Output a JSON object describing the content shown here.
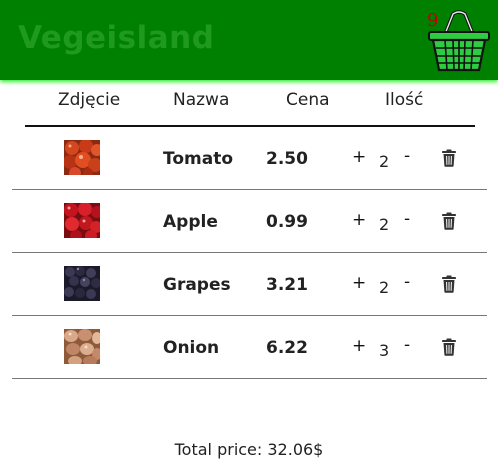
{
  "app": {
    "brand": "Vegeisland",
    "cart_count": "9"
  },
  "table": {
    "headers": {
      "photo": "Zdjęcie",
      "name": "Nazwa",
      "price": "Cena",
      "qty": "Ilość"
    },
    "items": [
      {
        "name": "Tomato",
        "price": "2.50",
        "qty": "2",
        "plus": "+",
        "minus": "-",
        "image": "tomato-photo"
      },
      {
        "name": "Apple",
        "price": "0.99",
        "qty": "2",
        "plus": "+",
        "minus": "-",
        "image": "apple-photo"
      },
      {
        "name": "Grapes",
        "price": "3.21",
        "qty": "2",
        "plus": "+",
        "minus": "-",
        "image": "grapes-photo"
      },
      {
        "name": "Onion",
        "price": "6.22",
        "qty": "3",
        "plus": "+",
        "minus": "-",
        "image": "onion-photo"
      }
    ]
  },
  "footer": {
    "total": "Total price: 32.06$"
  },
  "colors": {
    "header": "#008000",
    "brand": "#1f9a1f",
    "cart_count": "#c00000"
  },
  "icons": {
    "cart": "basket-icon",
    "delete": "trash-icon"
  }
}
